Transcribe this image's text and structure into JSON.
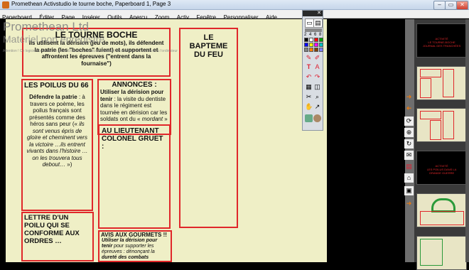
{
  "window": {
    "title": "Promethean Activstudio  le tourne boche, Paperboard 1, Page 3",
    "minimize": "–",
    "maximize": "▭",
    "close": "✕"
  },
  "menu": [
    "Paperboard",
    "Éditer",
    "Page",
    "Insérer",
    "Outils",
    "Aperçu",
    "Zoom",
    "Activ",
    "Fenêtre",
    "Personnaliser",
    "Aide"
  ],
  "ghost": {
    "title": "Promethean Ltd",
    "subtitle": "Matériel non enregistré",
    "note": "Attention ! Ce logiciel s'exécute en mode Évaluation car aucun matériel Promethean est connecté à l'ordinateur"
  },
  "boxes": {
    "tourne_boche": {
      "title": "LE TOURNE BOCHE",
      "text": "Ils utilisent la dérision (jeu de mots), ils défendent la patrie (les \"boches\" fuient) et supportent et affrontent les épreuves (\"entrent dans la fournaise\")"
    },
    "bapteme": {
      "title": "LE BAPTEME DU FEU"
    },
    "poilus": {
      "title": "LES POILUS DU 66",
      "lead": "Défendre la patrie",
      "text1": " : à travers ce poème, les poilus français sont présentés comme des héros sans peur (« ",
      "italic": "ils sont venus épris de gloire et cheminent vers la victoire …ils entrent vivants dans l'histoire … on les trouvera tous debout…",
      "text2": " »)"
    },
    "annonces": {
      "title": "ANNONCES :",
      "lead": "Utiliser la dérision pour tenir",
      "text": " : la visite du dentiste dans le régiment est tournée en dérision car les soldats ont du « ",
      "italic": "mordant",
      "text2": " »"
    },
    "lieutenant": {
      "title": "AU LIEUTENANT COLONEL GRUET :"
    },
    "lettre": {
      "title": "LETTRE D'UN POILU QUI SE CONFORME AUX ORDRES …"
    },
    "gourmets": {
      "title": "AVIS AUX GOURMETS !!",
      "lead": "Utiliser la dérision pour tenir",
      "text": " pour supporter les épreuves : dénonçant la ",
      "bold2": "dureté des combats"
    }
  },
  "toolbar": {
    "close": "✕",
    "numbers": "2 4 6 8",
    "colors": [
      "#000000",
      "#ffffff",
      "#ff0000",
      "#00a000",
      "#0000ff",
      "#ffff00",
      "#ff00ff",
      "#00c0c0",
      "#808080",
      "#ff8000",
      "#804000",
      "#8080ff"
    ],
    "tools": [
      "✎",
      "✐",
      "T",
      "A",
      "↶",
      "↷",
      "▦",
      "◫",
      "✂",
      "⌕",
      "✋",
      "↗"
    ]
  },
  "side_tools": [
    "➜",
    "➜",
    "⟳",
    "⊕",
    "↻",
    "✉",
    "▤",
    "⌂",
    "▣",
    "➜"
  ],
  "thumbs": [
    {
      "style": "dark",
      "text": "ACTIVITÉ\nLE TOURNE-BOCHE JOURNAL DES TRANCHÉES"
    },
    {
      "style": "light",
      "text": ""
    },
    {
      "style": "light",
      "text": ""
    },
    {
      "style": "dark",
      "text": "ACTIVITÉ\nLES POILUS DANS LA GRANDE GUERRE"
    },
    {
      "style": "light",
      "text": ""
    },
    {
      "style": "light",
      "text": ""
    }
  ]
}
